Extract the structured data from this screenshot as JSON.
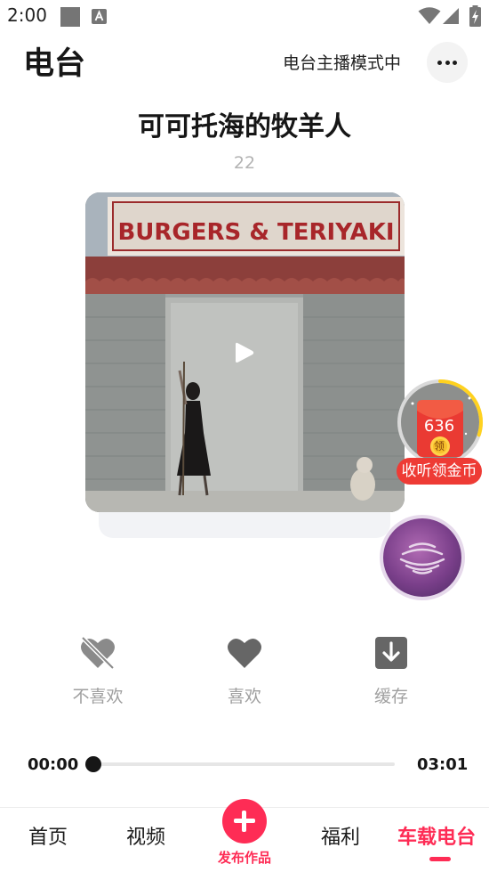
{
  "status_bar": {
    "time": "2:00",
    "icons": [
      "notification-square-icon",
      "keyboard-a-icon",
      "wifi-icon",
      "signal-icon",
      "battery-charging-icon"
    ]
  },
  "header": {
    "title": "电台",
    "mode_label": "电台主播模式中",
    "more_icon": "more-horizontal-icon"
  },
  "track": {
    "title": "可可托海的牧羊人",
    "count": "22",
    "cover_sign_text": "BURGERS & TERIYAKI",
    "play_icon": "play-icon"
  },
  "coin_widget": {
    "count": "636",
    "claim": "领",
    "label": "收听领金币",
    "progress": 0.3,
    "accent_color": "#ee3b35",
    "ring_color": "#ffd21f"
  },
  "voice_orb": {
    "icon": "voice-assistant-icon"
  },
  "actions": [
    {
      "label": "不喜欢",
      "icon": "dislike-heart-icon"
    },
    {
      "label": "喜欢",
      "icon": "heart-icon"
    },
    {
      "label": "缓存",
      "icon": "download-icon"
    }
  ],
  "player": {
    "current_time": "00:00",
    "total_time": "03:01",
    "progress": 0.0
  },
  "bottom_nav": {
    "items": [
      {
        "label": "首页",
        "active": false
      },
      {
        "label": "视频",
        "active": false
      },
      {
        "label": "福利",
        "active": false
      },
      {
        "label": "车载电台",
        "active": true
      }
    ],
    "publish_label": "发布作品",
    "accent_color": "#fe2c55"
  }
}
